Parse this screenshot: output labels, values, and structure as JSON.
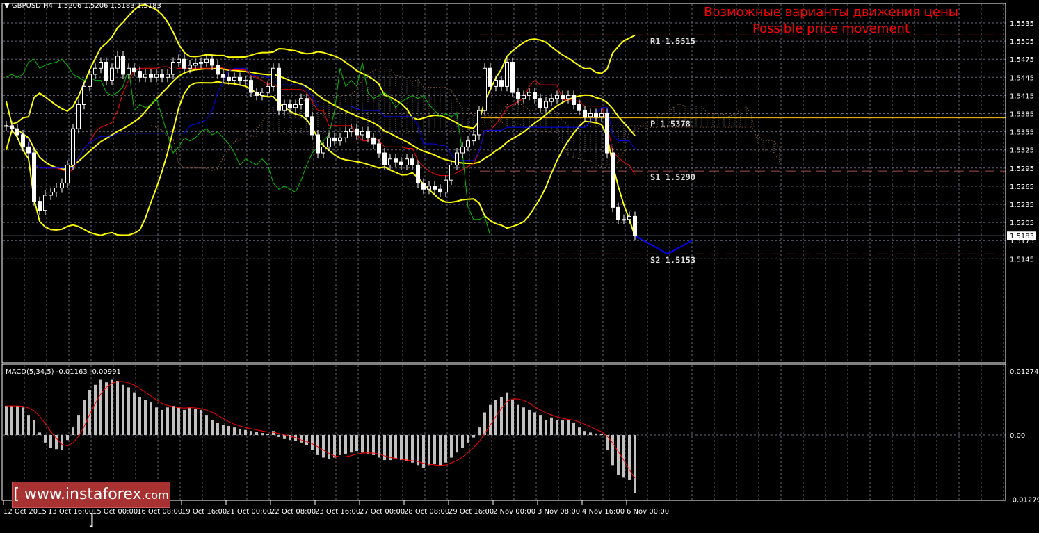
{
  "header": {
    "symbol": "GBPUSD,H4",
    "ohlc": "1.5206 1.5206 1.5183 1.5183"
  },
  "overlay": {
    "line1": "Возможные варианты движения цены",
    "line2": "Possible price movement"
  },
  "logo": {
    "text": "www.instaforex",
    "suffix": ".com"
  },
  "colors": {
    "up": "#ffffff",
    "down": "#ffffff",
    "bollinger": "#ffff00",
    "tenkan": "#ff0000",
    "kijun": "#0000ff",
    "chikou": "#00c000",
    "forecast": "#0000ff"
  },
  "chart_data": [
    {
      "type": "candlestick",
      "title": "GBPUSD,H4",
      "ylim": [
        1.513,
        1.557
      ],
      "yticks": [
        "1.5535",
        "1.5505",
        "1.5475",
        "1.5445",
        "1.5415",
        "1.5385",
        "1.5355",
        "1.5325",
        "1.5295",
        "1.5265",
        "1.5235",
        "1.5205",
        "1.5175",
        "1.5145"
      ],
      "current_price": "1.5183",
      "xticks": [
        "12 Oct 2015",
        "13 Oct 16:00",
        "15 Oct 00:00",
        "16 Oct 08:00",
        "19 Oct 16:00",
        "21 Oct 00:00",
        "22 Oct 08:00",
        "23 Oct 16:00",
        "27 Oct 00:00",
        "28 Oct 08:00",
        "29 Oct 16:00",
        "2 Nov 00:00",
        "3 Nov 08:00",
        "4 Nov 16:00",
        "6 Nov 00:00"
      ],
      "closes": [
        1.5365,
        1.536,
        1.535,
        1.533,
        1.532,
        1.524,
        1.5225,
        1.525,
        1.5255,
        1.5262,
        1.527,
        1.53,
        1.536,
        1.54,
        1.543,
        1.545,
        1.546,
        1.547,
        1.544,
        1.546,
        1.548,
        1.545,
        1.546,
        1.5455,
        1.5445,
        1.545,
        1.5445,
        1.545,
        1.5445,
        1.545,
        1.547,
        1.5475,
        1.546,
        1.5465,
        1.5468,
        1.547,
        1.5475,
        1.5465,
        1.545,
        1.5445,
        1.544,
        1.5445,
        1.544,
        1.544,
        1.542,
        1.5415,
        1.542,
        1.543,
        1.546,
        1.539,
        1.54,
        1.5395,
        1.54,
        1.541,
        1.538,
        1.535,
        1.532,
        1.533,
        1.5345,
        1.534,
        1.5345,
        1.5355,
        1.536,
        1.535,
        1.5355,
        1.5345,
        1.5335,
        1.532,
        1.53,
        1.531,
        1.5305,
        1.53,
        1.531,
        1.53,
        1.527,
        1.526,
        1.5265,
        1.526,
        1.5255,
        1.5275,
        1.53,
        1.532,
        1.533,
        1.534,
        1.535,
        1.539,
        1.546,
        1.543,
        1.544,
        1.543,
        1.547,
        1.542,
        1.541,
        1.5415,
        1.542,
        1.541,
        1.5395,
        1.5405,
        1.541,
        1.5415,
        1.541,
        1.5415,
        1.54,
        1.539,
        1.538,
        1.5385,
        1.538,
        1.5385,
        1.532,
        1.523,
        1.521,
        1.521,
        1.5215,
        1.5183
      ],
      "levels": [
        {
          "label": "R1",
          "value": "1.5515",
          "color": "#ff3000",
          "style": "dashed"
        },
        {
          "label": "P",
          "value": "1.5378",
          "color": "#ffc000",
          "style": "solid"
        },
        {
          "label": "S1",
          "value": "1.5290",
          "color": "#a05050",
          "style": "dashed"
        },
        {
          "label": "S2",
          "value": "1.5153",
          "color": "#c04030",
          "style": "dashed"
        }
      ],
      "forecast_path": [
        1.5183,
        1.5153,
        1.5175
      ]
    },
    {
      "type": "bar",
      "title": "MACD(5,34,5) -0.01163 -0.00991",
      "ylim": [
        -0.01279,
        0.01274
      ],
      "yticks": [
        "0.01274",
        "0.00",
        "-0.01279"
      ],
      "histogram": [
        0.0058,
        0.0058,
        0.0058,
        0.0055,
        0.004,
        0.003,
        0.0005,
        -0.0015,
        -0.0025,
        -0.0028,
        -0.003,
        -0.001,
        0.0015,
        0.004,
        0.007,
        0.009,
        0.01,
        0.011,
        0.0105,
        0.011,
        0.0108,
        0.01,
        0.0095,
        0.0085,
        0.0075,
        0.007,
        0.0065,
        0.0055,
        0.005,
        0.0055,
        0.0058,
        0.0055,
        0.005,
        0.0055,
        0.0052,
        0.005,
        0.004,
        0.003,
        0.0025,
        0.002,
        0.0018,
        0.0015,
        0.0012,
        0.001,
        0.0008,
        0.0006,
        0.0004,
        0.0002,
        0.0008,
        -0.0004,
        -0.0008,
        -0.001,
        -0.0012,
        -0.0015,
        -0.002,
        -0.003,
        -0.004,
        -0.0045,
        -0.0048,
        -0.0045,
        -0.004,
        -0.0038,
        -0.0035,
        -0.0032,
        -0.0035,
        -0.0038,
        -0.004,
        -0.0045,
        -0.005,
        -0.005,
        -0.0048,
        -0.005,
        -0.0052,
        -0.0055,
        -0.006,
        -0.0065,
        -0.006,
        -0.0058,
        -0.006,
        -0.0055,
        -0.0045,
        -0.0035,
        -0.0025,
        -0.0015,
        -0.0005,
        0.0015,
        0.0045,
        0.006,
        0.007,
        0.0075,
        0.0085,
        0.007,
        0.006,
        0.0055,
        0.005,
        0.0045,
        0.004,
        0.003,
        0.0035,
        0.003,
        0.003,
        0.003,
        0.0025,
        0.0015,
        0.0008,
        0.0005,
        0.0003,
        0.0002,
        -0.003,
        -0.006,
        -0.008,
        -0.0085,
        -0.009,
        -0.0116
      ]
    }
  ]
}
